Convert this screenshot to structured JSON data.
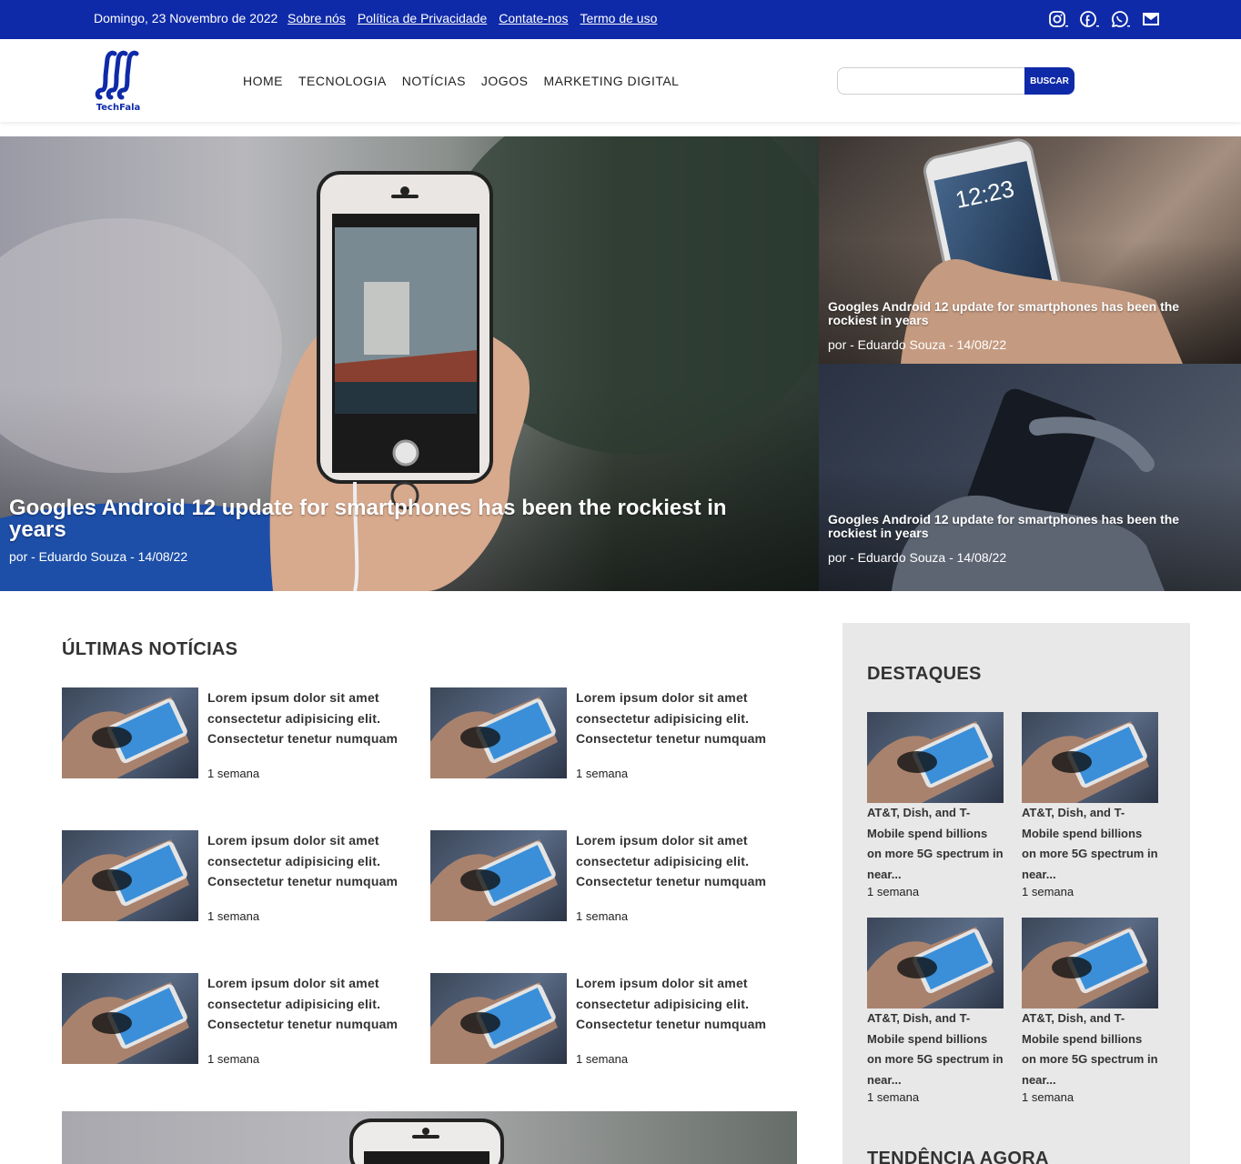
{
  "topbar": {
    "date": "Domingo, 23 Novembro de 2022",
    "links": [
      "Sobre nós",
      "Política de Privacidade",
      "Contate-nos",
      "Termo de uso"
    ],
    "social_icons": [
      "instagram-icon",
      "facebook-icon",
      "whatsapp-icon",
      "email-icon"
    ],
    "bg_color": "#0f2aa8"
  },
  "header": {
    "logo_text": "TechFala",
    "nav": [
      "HOME",
      "TECNOLOGIA",
      "NOTÍCIAS",
      "JOGOS",
      "MARKETING DIGITAL"
    ],
    "search_placeholder": "",
    "search_button": "BUSCAR"
  },
  "hero": {
    "main": {
      "title": "Googles Android 12 update for smartphones has been the rockiest in years",
      "meta": "por - Eduardo Souza - 14/08/22"
    },
    "side": [
      {
        "title": "Googles Android 12 update for smartphones has been the rockiest in years",
        "meta": "por - Eduardo Souza - 14/08/22"
      },
      {
        "title": "Googles Android 12 update for smartphones has been the rockiest in years",
        "meta": "por - Eduardo Souza - 14/08/22"
      }
    ]
  },
  "latest": {
    "title": "ÚLTIMAS NOTÍCIAS",
    "items": [
      {
        "title": "Lorem ipsum dolor sit amet consectetur adipisicing elit. Consectetur tenetur numquam",
        "time": "1 semana"
      },
      {
        "title": "Lorem ipsum dolor sit amet consectetur adipisicing elit. Consectetur tenetur numquam",
        "time": "1 semana"
      },
      {
        "title": "Lorem ipsum dolor sit amet consectetur adipisicing elit. Consectetur tenetur numquam",
        "time": "1 semana"
      },
      {
        "title": "Lorem ipsum dolor sit amet consectetur adipisicing elit. Consectetur tenetur numquam",
        "time": "1 semana"
      },
      {
        "title": "Lorem ipsum dolor sit amet consectetur adipisicing elit. Consectetur tenetur numquam",
        "time": "1 semana"
      },
      {
        "title": "Lorem ipsum dolor sit amet consectetur adipisicing elit. Consectetur tenetur numquam",
        "time": "1 semana"
      }
    ]
  },
  "sidebar": {
    "title": "DESTAQUES",
    "items": [
      {
        "title": "AT&T, Dish, and T-Mobile spend billions on more 5G spectrum in near...",
        "time": "1 semana"
      },
      {
        "title": "AT&T, Dish, and T-Mobile spend billions on more 5G spectrum in near...",
        "time": "1 semana"
      },
      {
        "title": "AT&T, Dish, and T-Mobile spend billions on more 5G spectrum in near...",
        "time": "1 semana"
      },
      {
        "title": "AT&T, Dish, and T-Mobile spend billions on more 5G spectrum in near...",
        "time": "1 semana"
      }
    ],
    "trending_title": "TENDÊNCIA AGORA"
  }
}
